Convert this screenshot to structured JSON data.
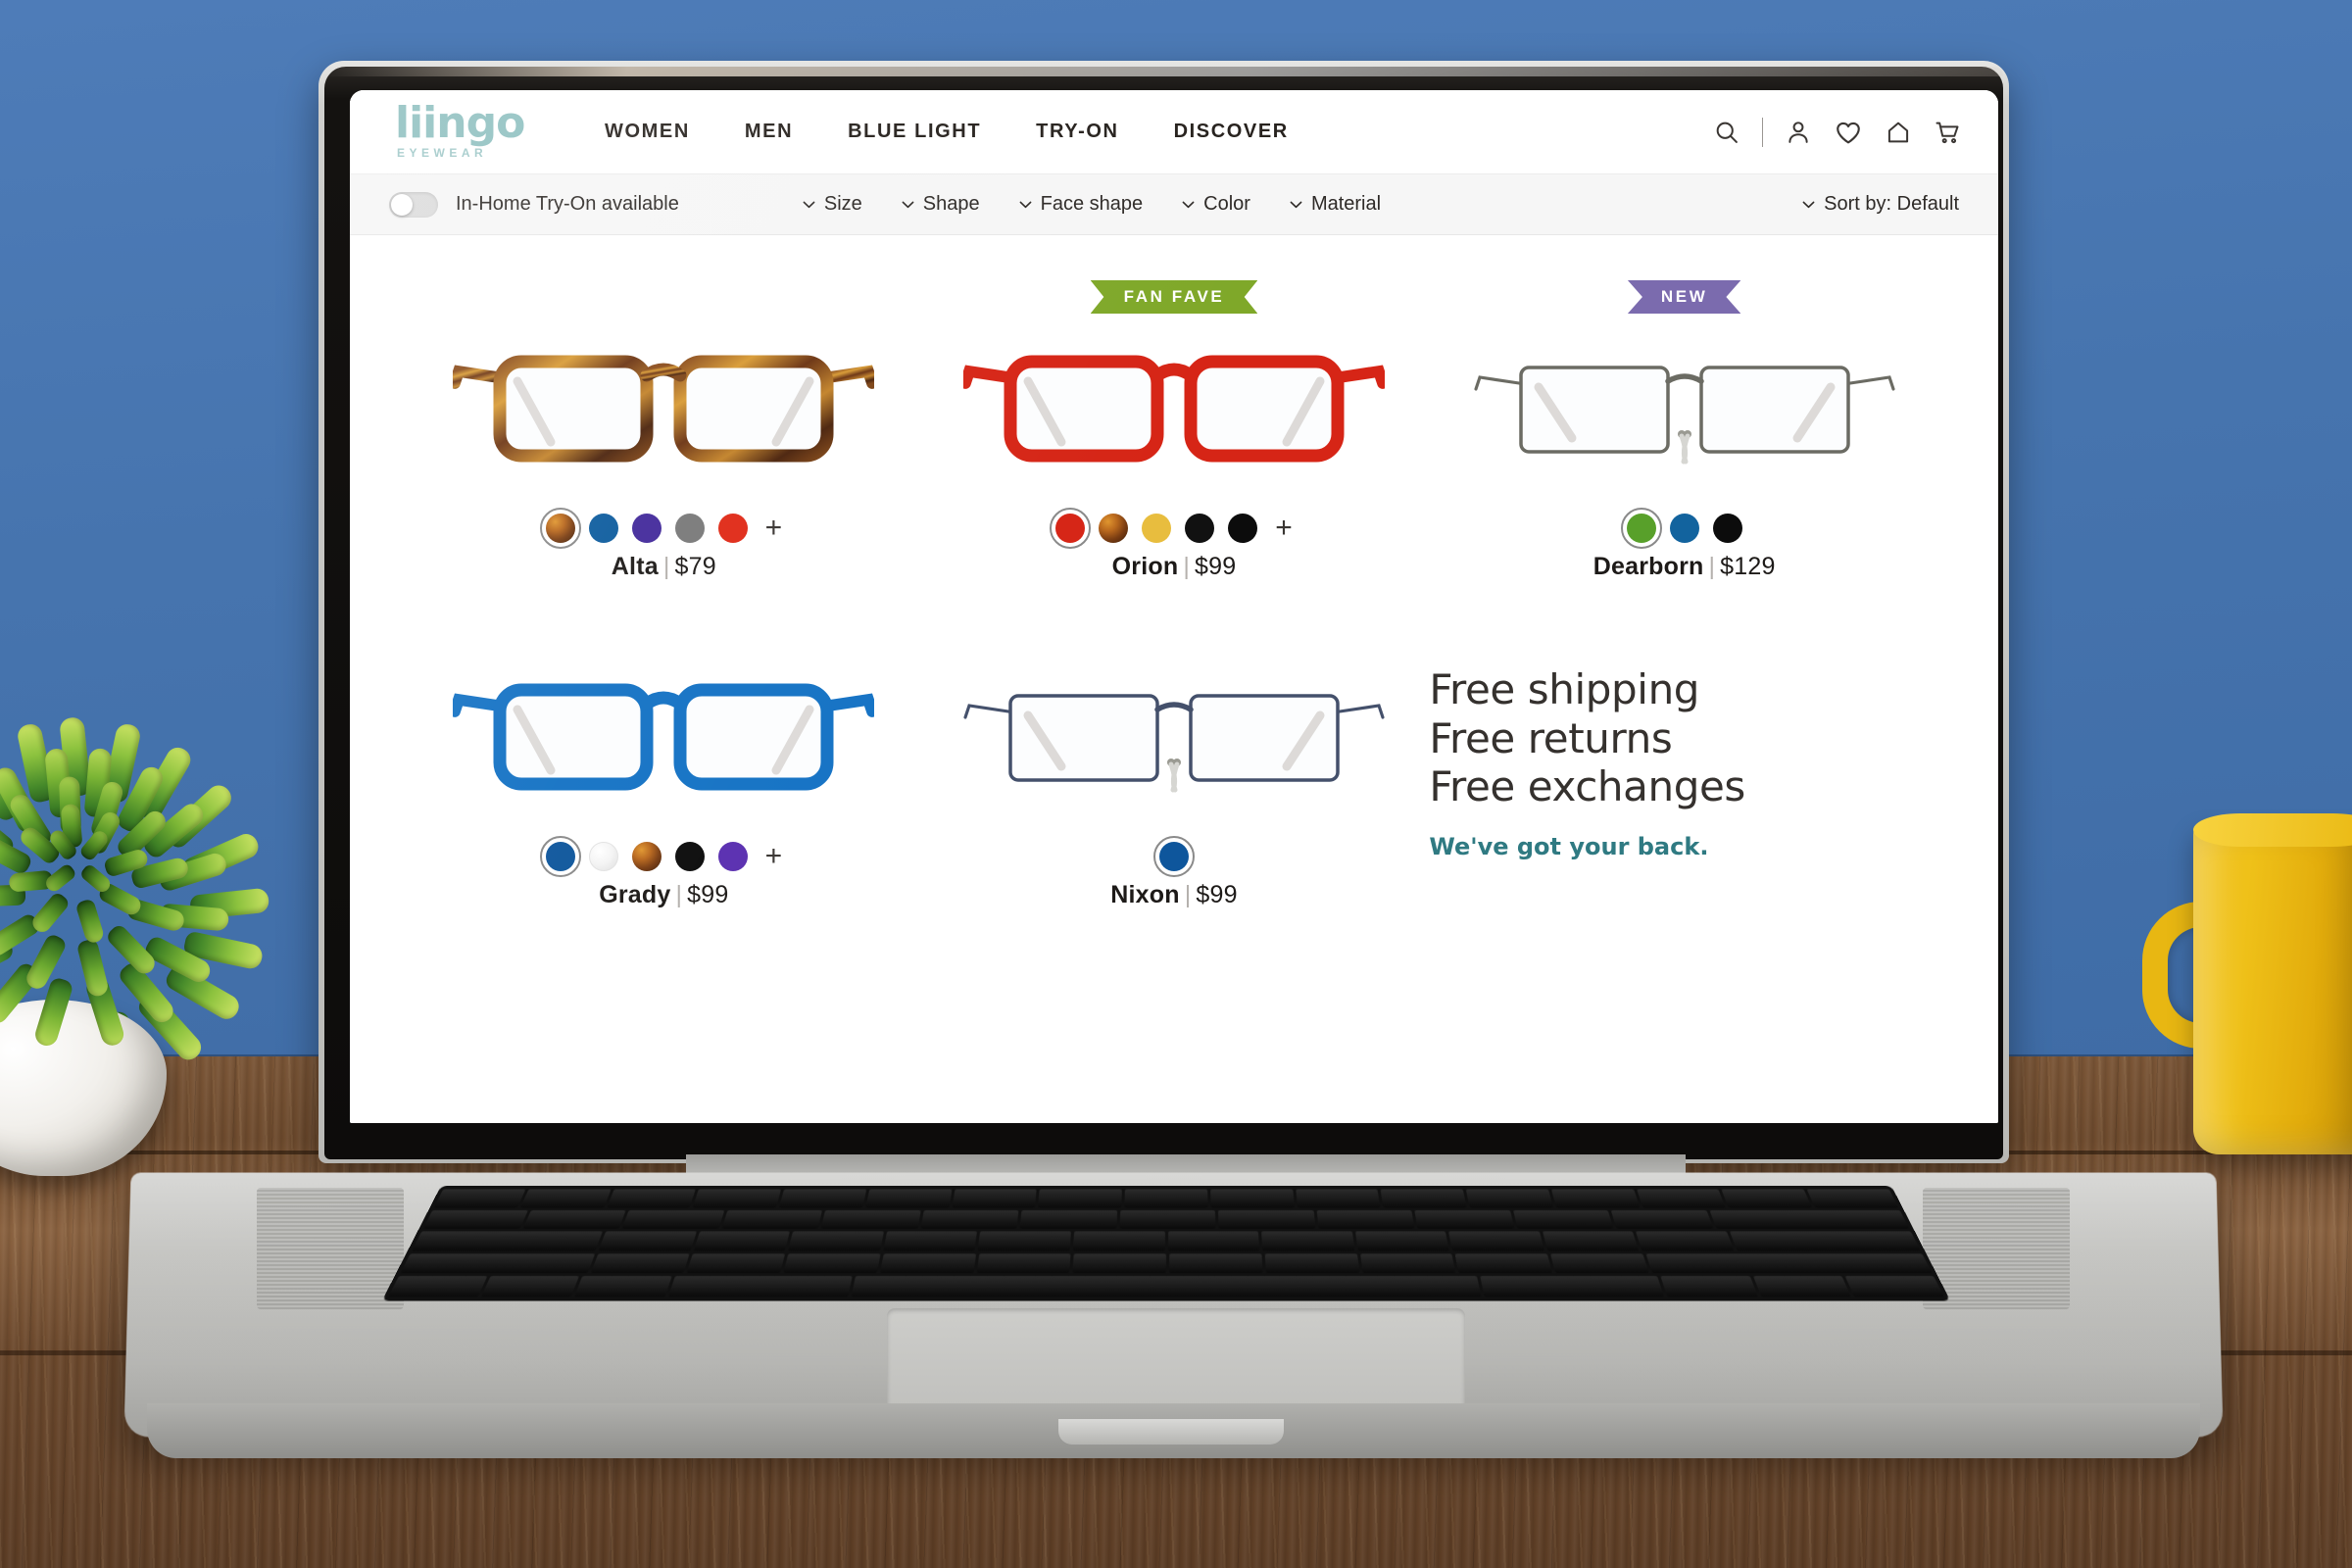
{
  "brand": {
    "logo_word": "liingo",
    "logo_sub": "EYEWEAR",
    "logo_color": "#8fc0c0"
  },
  "header": {
    "nav": [
      {
        "label": "WOMEN"
      },
      {
        "label": "MEN"
      },
      {
        "label": "BLUE LIGHT"
      },
      {
        "label": "TRY-ON"
      },
      {
        "label": "DISCOVER"
      }
    ],
    "icons": [
      {
        "name": "search-icon"
      },
      {
        "name": "account-icon"
      },
      {
        "name": "wishlist-heart-icon"
      },
      {
        "name": "home-icon"
      },
      {
        "name": "cart-icon"
      }
    ]
  },
  "filterbar": {
    "tryon_toggle_label": "In-Home Try-On available",
    "tryon_toggle_on": false,
    "filters": [
      {
        "label": "Size"
      },
      {
        "label": "Shape"
      },
      {
        "label": "Face shape"
      },
      {
        "label": "Color"
      },
      {
        "label": "Material"
      }
    ],
    "sort": {
      "label": "Sort by: Default"
    }
  },
  "products": [
    {
      "name": "Alta",
      "price": "$79",
      "separator": "|",
      "badge": null,
      "frame_type": "acetate",
      "frame_color": "#7a3d12",
      "swatches": [
        {
          "name": "tortoise",
          "color": "tortoise",
          "selected": true
        },
        {
          "name": "blue",
          "color": "#0d5c9e",
          "selected": false
        },
        {
          "name": "purple",
          "color": "#432a9b",
          "selected": false
        },
        {
          "name": "gray",
          "color": "#7a7a7a",
          "selected": false
        },
        {
          "name": "red",
          "color": "#e02b18",
          "selected": false
        }
      ],
      "more_label": "+"
    },
    {
      "name": "Orion",
      "price": "$99",
      "separator": "|",
      "badge": {
        "label": "FAN FAVE",
        "color": "#7fa829",
        "style": "fan"
      },
      "frame_type": "acetate",
      "frame_color": "#d62516",
      "swatches": [
        {
          "name": "red",
          "color": "#d62516",
          "selected": true
        },
        {
          "name": "tortoise",
          "color": "tortoise",
          "selected": false
        },
        {
          "name": "gold",
          "color": "#e8bd3e",
          "selected": false
        },
        {
          "name": "black",
          "color": "#111111",
          "selected": false
        },
        {
          "name": "black-matte",
          "color": "#0c0c0c",
          "selected": false
        }
      ],
      "more_label": "+"
    },
    {
      "name": "Dearborn",
      "price": "$129",
      "separator": "|",
      "badge": {
        "label": "NEW",
        "color": "#7b6bae",
        "style": "new"
      },
      "frame_type": "metal",
      "frame_color": "#6b6b63",
      "swatches": [
        {
          "name": "green",
          "color": "#58a02a",
          "selected": true
        },
        {
          "name": "blue",
          "color": "#12639e",
          "selected": false
        },
        {
          "name": "black",
          "color": "#0c0c0c",
          "selected": false
        }
      ],
      "more_label": null
    },
    {
      "name": "Grady",
      "price": "$99",
      "separator": "|",
      "badge": null,
      "frame_type": "acetate",
      "frame_color": "#1472c4",
      "swatches": [
        {
          "name": "blue",
          "color": "#0e569c",
          "selected": true
        },
        {
          "name": "clear",
          "color": "clear",
          "selected": false
        },
        {
          "name": "tortoise",
          "color": "tortoise",
          "selected": false
        },
        {
          "name": "black",
          "color": "#0c0c0c",
          "selected": false
        },
        {
          "name": "purple",
          "color": "#5a2fb0",
          "selected": false
        }
      ],
      "more_label": "+"
    },
    {
      "name": "Nixon",
      "price": "$99",
      "separator": "|",
      "badge": null,
      "frame_type": "metal",
      "frame_color": "#44506b",
      "swatches": [
        {
          "name": "blue",
          "color": "#0e569c",
          "selected": true
        }
      ],
      "more_label": null
    }
  ],
  "promo": {
    "line1": "Free shipping",
    "line2": "Free returns",
    "line3": "Free exchanges",
    "tagline": "We've got your back.",
    "tagline_color": "#2f7a82"
  }
}
